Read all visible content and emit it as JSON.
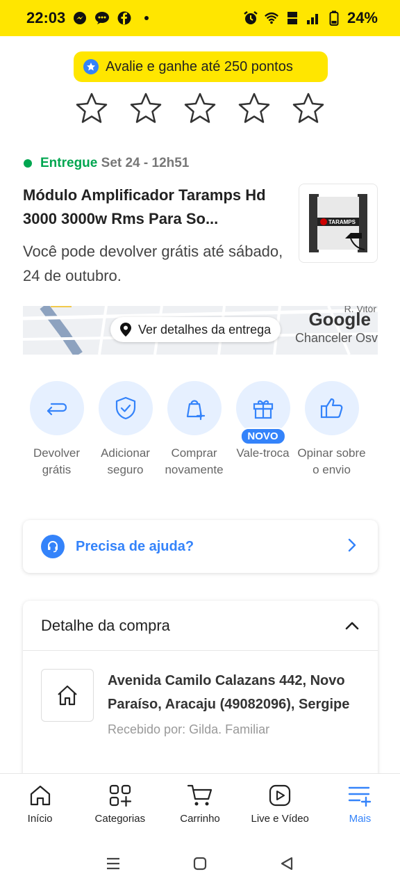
{
  "status_bar": {
    "time": "22:03",
    "battery": "24%",
    "icons": [
      "messenger-icon",
      "chat-icon",
      "facebook-icon",
      "dot-icon",
      "alarm-icon",
      "wifi-icon",
      "volte-icon",
      "signal-icon",
      "battery-icon"
    ]
  },
  "rating": {
    "banner_text": "Avalie e ganhe até 250 pontos",
    "stars": 5
  },
  "order": {
    "status": "Entregue",
    "date": "Set 24 - 12h51",
    "product_title": "Módulo Amplificador Taramps Hd 3000 3000w Rms Para So...",
    "return_note": "Você pode devolver grátis até sábado, 24 de outubro.",
    "product_brand": "TARAMPS"
  },
  "map": {
    "details_label": "Ver detalhes da entrega",
    "google": "Google",
    "street": "Chanceler Osv",
    "street_top": "R. Vitór"
  },
  "actions": [
    {
      "label": "Devolver grátis",
      "icon": "return-icon"
    },
    {
      "label": "Adicionar seguro",
      "icon": "shield-check-icon"
    },
    {
      "label": "Comprar novamente",
      "icon": "bag-plus-icon"
    },
    {
      "label": "Vale-troca",
      "icon": "gift-icon",
      "badge": "NOVO"
    },
    {
      "label": "Opinar sobre o envio",
      "icon": "thumbs-up-icon"
    }
  ],
  "help": {
    "label": "Precisa de ajuda?"
  },
  "purchase_detail": {
    "title": "Detalhe da compra",
    "address": "Avenida Camilo Calazans 442, Novo Paraíso, Aracaju (49082096), Sergipe",
    "received_by": "Recebido por: Gilda. Familiar"
  },
  "tabbar": {
    "items": [
      {
        "label": "Início",
        "icon": "home-icon"
      },
      {
        "label": "Categorias",
        "icon": "categories-icon"
      },
      {
        "label": "Carrinho",
        "icon": "cart-icon"
      },
      {
        "label": "Live e Vídeo",
        "icon": "video-icon"
      },
      {
        "label": "Mais",
        "icon": "menu-plus-icon",
        "active": true
      }
    ]
  },
  "colors": {
    "brand_yellow": "#ffe600",
    "accent_blue": "#3483fa",
    "success_green": "#00a650"
  }
}
